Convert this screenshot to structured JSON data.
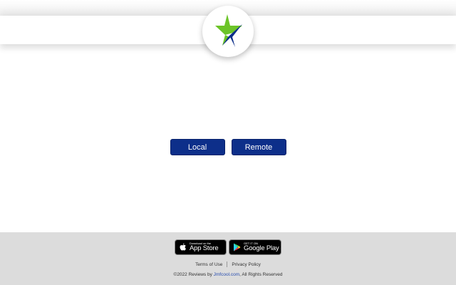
{
  "buttons": {
    "local": "Local",
    "remote": "Remote"
  },
  "footer": {
    "app_store": {
      "small": "Download on the",
      "big": "App Store"
    },
    "google_play": {
      "small": "GET IT ON",
      "big": "Google Play"
    },
    "links": {
      "terms": "Terms of Use",
      "privacy": "Privacy Policy"
    },
    "copyright_prefix": "©2022 Reviews by ",
    "copyright_link": "Jmfcool.com",
    "copyright_suffix": ", All Rights Reserved"
  },
  "colors": {
    "button": "#0d2f8a",
    "star_green": "#6cc428",
    "star_blue": "#0d2f8a",
    "footer_bg": "#dcdcdc"
  },
  "icons": {
    "logo": "star-logo-icon",
    "apple": "apple-icon",
    "play": "google-play-icon"
  }
}
